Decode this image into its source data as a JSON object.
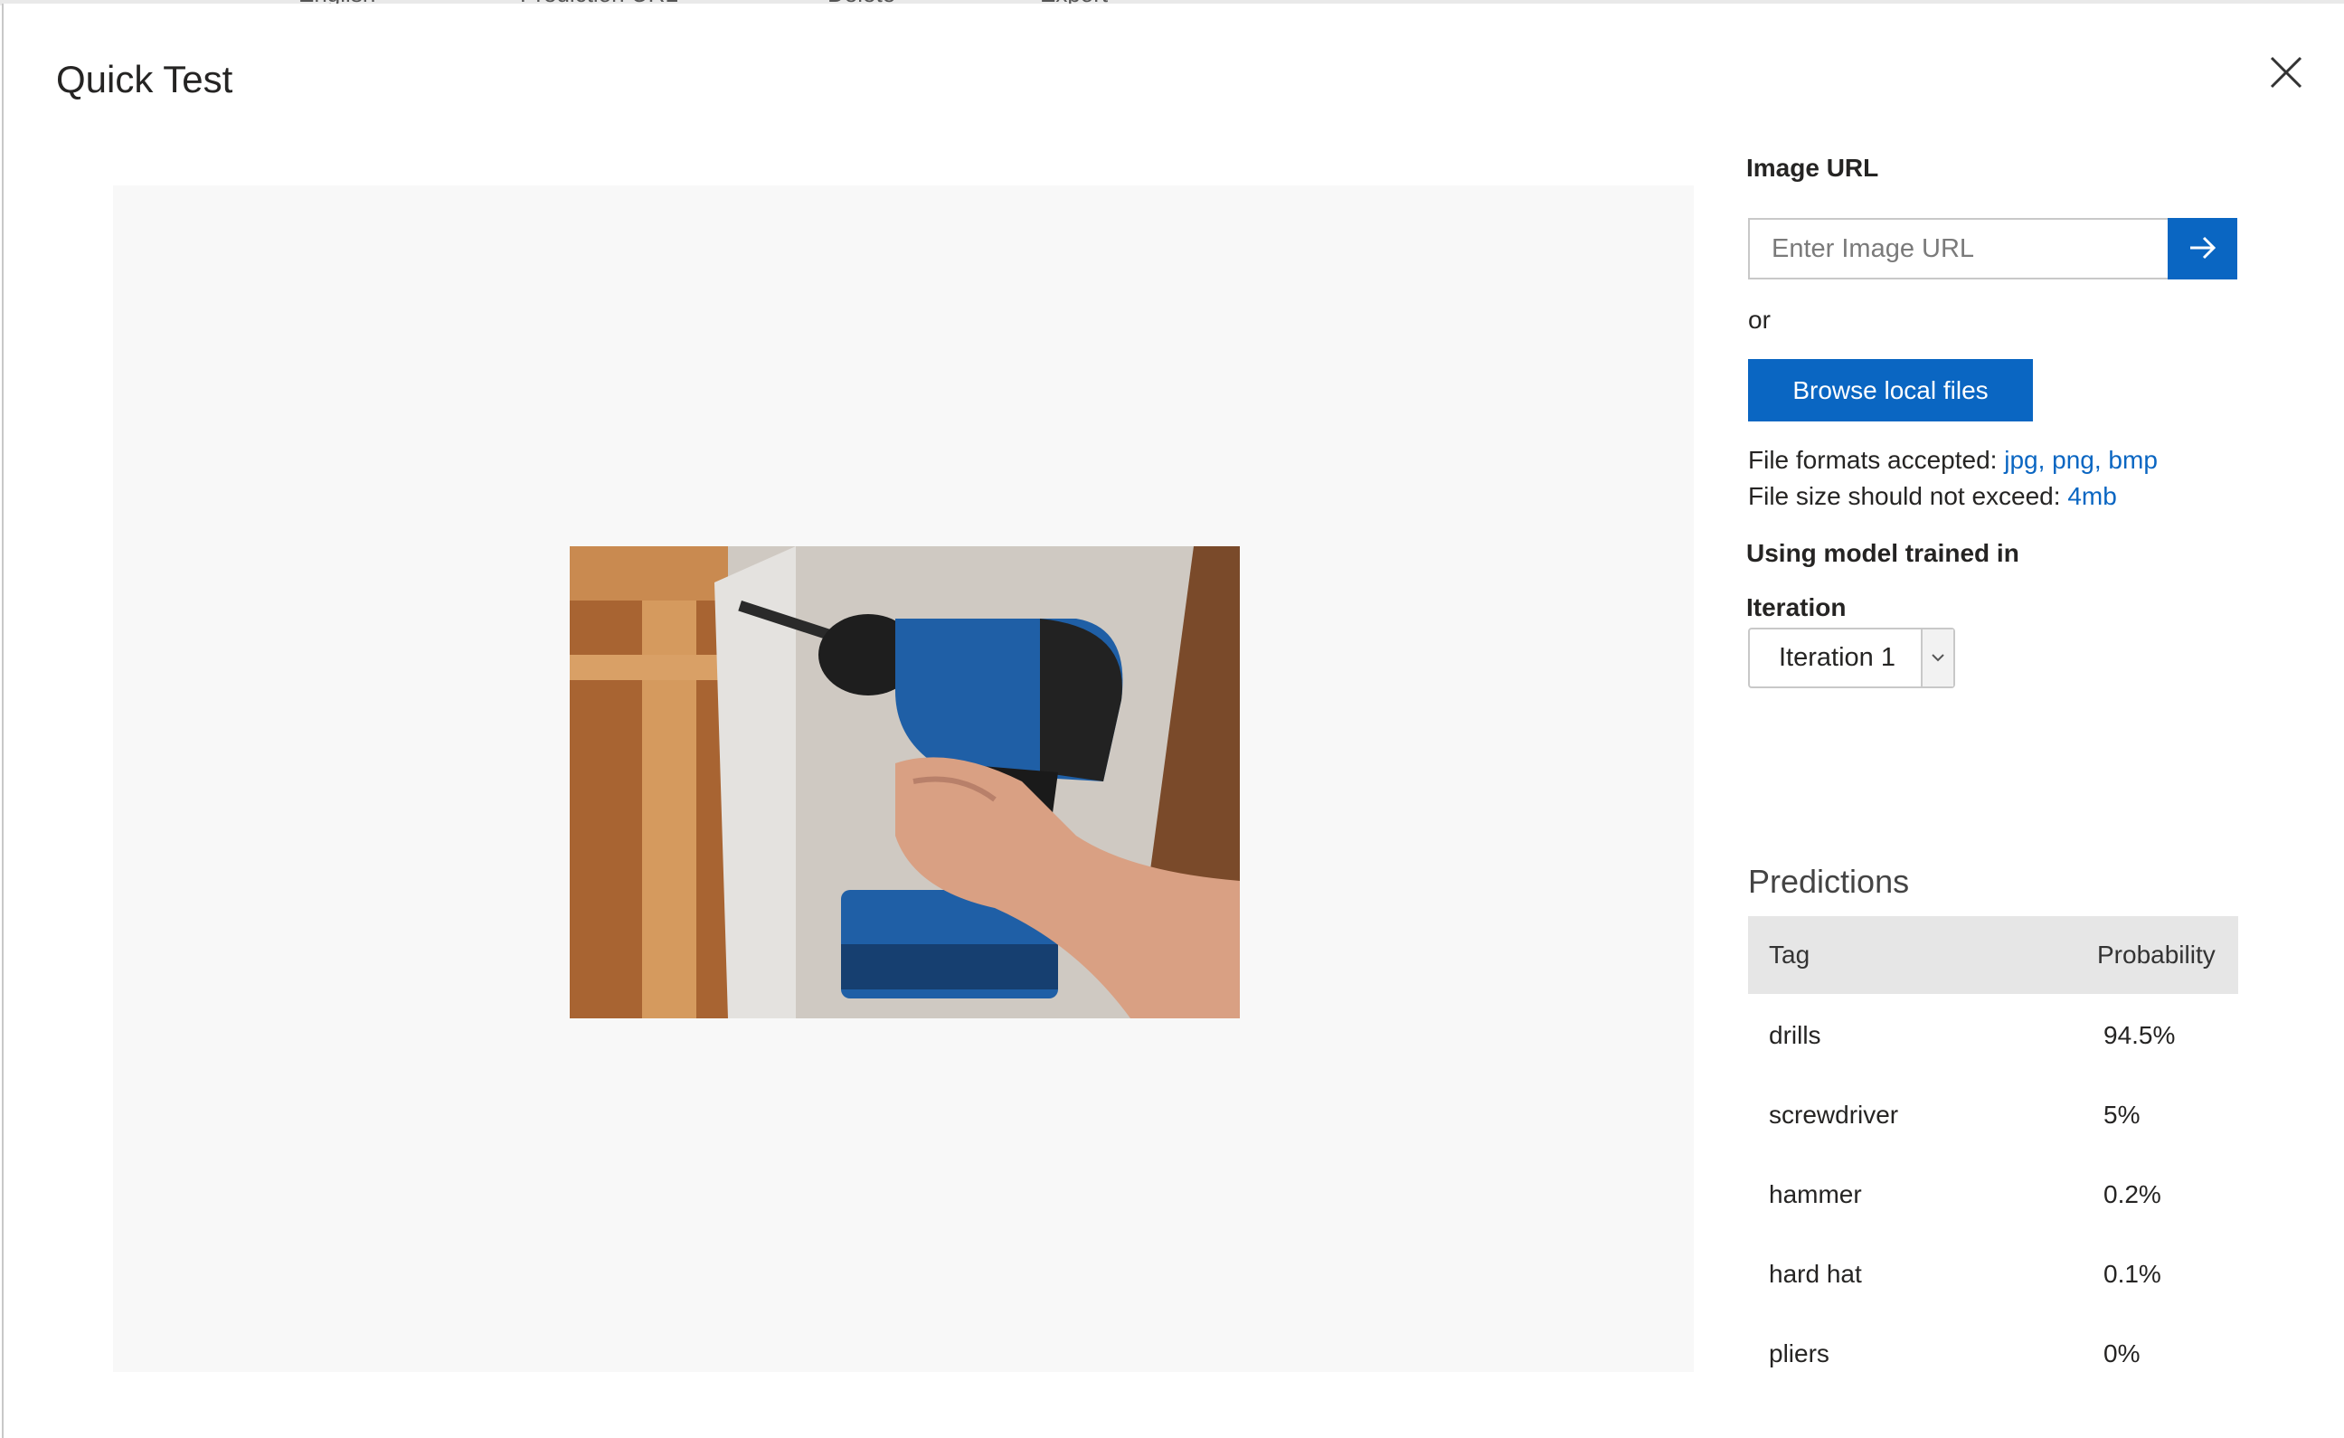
{
  "background_toolbar": {
    "items": [
      "English",
      "Prediction URL",
      "Delete",
      "Export"
    ]
  },
  "dialog": {
    "title": "Quick Test",
    "close_icon": "close-icon"
  },
  "image_url": {
    "label": "Image URL",
    "placeholder": "Enter Image URL",
    "value": "",
    "submit_icon": "arrow-right-icon"
  },
  "or_text": "or",
  "browse_button": "Browse local files",
  "file_info": {
    "formats_label": "File formats accepted: ",
    "formats_value": "jpg, png, bmp",
    "size_label": "File size should not exceed: ",
    "size_value": "4mb"
  },
  "model": {
    "heading": "Using model trained in",
    "iteration_label": "Iteration",
    "iteration_selected": "Iteration 1"
  },
  "predictions": {
    "title": "Predictions",
    "headers": {
      "tag": "Tag",
      "probability": "Probability"
    },
    "rows": [
      {
        "tag": "drills",
        "probability": "94.5%"
      },
      {
        "tag": "screwdriver",
        "probability": "5%"
      },
      {
        "tag": "hammer",
        "probability": "0.2%"
      },
      {
        "tag": "hard hat",
        "probability": "0.1%"
      },
      {
        "tag": "pliers",
        "probability": "0%"
      }
    ]
  },
  "colors": {
    "accent": "#0a66c2",
    "preview_bg": "#f8f8f8",
    "table_header_bg": "#e6e6e6"
  }
}
